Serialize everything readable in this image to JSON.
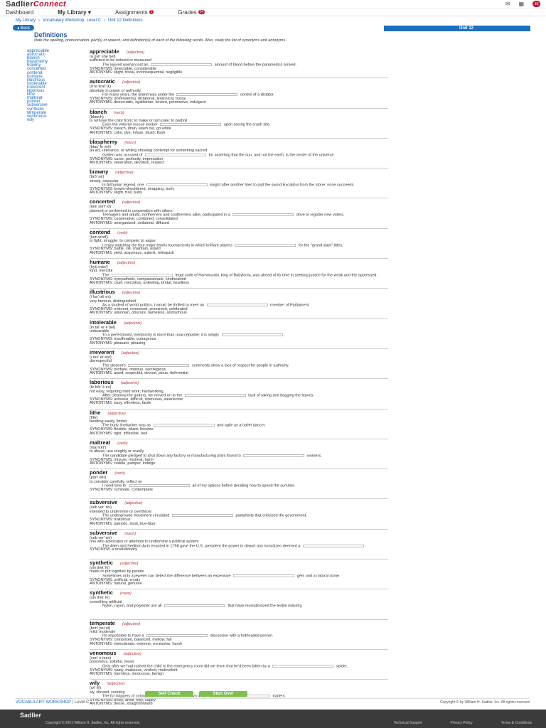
{
  "header": {
    "brand1": "Sadlier",
    "brand2": "Connect",
    "icon1": "envelope-icon",
    "icon2": "calendar-icon",
    "avatar": "JS"
  },
  "nav": {
    "dashboard": "Dashboard",
    "library": "My Library ▾",
    "assignments": "Assignments",
    "assign_badge": "1",
    "grades": "Grades",
    "grades_badge": "24"
  },
  "breadcrumb": {
    "a": "My Library",
    "b": "Vocabulary Workshop, Level C",
    "c": "Unit 12 Definitions"
  },
  "back": "◂ Back",
  "unit": "Unit 12",
  "title": "Definitions",
  "intro": "Note the spelling, pronunciation, part(s) of speech, and definition(s) of each of the following words. Also, study the list of synonyms and antonyms.",
  "sidebar": [
    "appreciable",
    "autocratic",
    "blanch",
    "blasphemy",
    "brawny",
    "concerted",
    "contend",
    "humane",
    "illustrious",
    "intolerable",
    "irreverent",
    "laborious",
    "lithe",
    "maltreat",
    "ponder",
    "subversive",
    "synthetic",
    "temperate",
    "venomous",
    "wily"
  ],
  "entries": [
    {
      "w": "appreciable",
      "p": "(adjective)",
      "pr": "(a prē' she bel)",
      "d": "sufficient to be noticed or measured",
      "e": "The injured woman lost an ____ amount of blood before the paramedics arrived.",
      "s": "SYNONYMS: detectable, considerable",
      "a": "ANTONYMS: slight, trivial, inconsequential, negligible"
    },
    {
      "w": "autocratic",
      "p": "(adjective)",
      "pr": "(ô te krat' ik)",
      "d": "absolute in power or authority",
      "e": "For many years, the island was under the ____ control of a dictator.",
      "s": "SYNONYMS: domineering, dictatorial, tyrannical, bossy",
      "a": "ANTONYMS: democratic, egalitarian, lenient, permissive, indulgent"
    },
    {
      "w": "blanch",
      "p": "(verb)",
      "pr": "(blanch)",
      "d": "to remove the color from; to make or turn pale; to parboil",
      "e": "Even the veteran rescue worker ____ upon seeing the crash site.",
      "s": "SYNONYMS: bleach, drain, wash out, go white",
      "a": "ANTONYMS: color, dye, infuse, blush, flush"
    },
    {
      "w": "blasphemy",
      "p": "(noun)",
      "pr": "(blas' fe mē)",
      "d": "an act, utterance, or writing showing contempt for something sacred",
      "e": "Galileo was accused of ____ for asserting that the sun, and not the earth, is the center of the universe.",
      "s": "SYNONYMS: curse, profanity, imprecation",
      "a": "ANTONYMS: veneration, devotion, respect"
    },
    {
      "w": "brawny",
      "p": "(adjective)",
      "pr": "(brô' nē)",
      "d": "strong, muscular",
      "e": "In Arthurian legend, one ____ knight after another tries to pull the sword Excalibur from the stone; none succeeds.",
      "s": "SYNONYMS: brawn-shouldered, strapping, burly",
      "a": "ANTONYMS: slight, frail, puny"
    },
    {
      "w": "concerted",
      "p": "(adjective)",
      "pr": "(ken sert' id)",
      "d": "planned or performed in cooperation with others",
      "e": "Teenagers and adults, northerners and southerners alike, participated in a ____ drive to register new voters.",
      "s": "SYNONYMS: cooperative, combined, consolidated",
      "a": "ANTONYMS: unorganized, unilateral, diffused"
    },
    {
      "w": "contend",
      "p": "(verb)",
      "pr": "(ken tend')",
      "d": "to fight, struggle; to compete; to argue",
      "e": "I enjoy watching the four major tennis tournaments in which brilliant players ____ for the \"grand slam\" titles.",
      "s": "SYNONYMS: battle, vie, maintain, assert",
      "a": "ANTONYMS: yield, acquiesce, submit, relinquish"
    },
    {
      "w": "humane",
      "p": "(adjective)",
      "pr": "(hyü mān')",
      "d": "kind, merciful",
      "e": "The ____ legal code of Hammurabi, king of Babylonia, was ahead of its time in seeking justice for the weak and the oppressed.",
      "s": "SYNONYMS: sympathetic, compassionate, kindhearted",
      "a": "ANTONYMS: cruel, merciless, unfeeling, brutal, heartless"
    },
    {
      "w": "illustrious",
      "p": "(adjective)",
      "pr": "(i lus' trē es)",
      "d": "very famous, distinguished",
      "e": "As a student of world politics, I would be thrilled to meet an ____ member of Parliament.",
      "s": "SYNONYMS: eminent, renowned, prominent, celebrated",
      "a": "ANTONYMS: unknown, obscure, nameless, anonymous"
    },
    {
      "w": "intolerable",
      "p": "(adjective)",
      "pr": "(in täl' er e bel)",
      "d": "unbearable",
      "e": "To a perfectionist, mediocrity is more than unacceptable; it is simply ____.",
      "s": "SYNONYMS: insufferable, outrageous",
      "a": "ANTONYMS: pleasant, pleasing"
    },
    {
      "w": "irreverent",
      "p": "(adjective)",
      "pr": "(i rev' er ent)",
      "d": "disrespectful",
      "e": "The student's ____ comments show a lack of respect for people in authority.",
      "s": "SYNONYMS: profane, impious, sacrilegious",
      "a": "ANTONYMS: awed, respectful, devout, pious, deferential"
    },
    {
      "w": "laborious",
      "p": "(adjective)",
      "pr": "(le bôr' ē es)",
      "d": "not easy, requiring hard work; hardworking",
      "e": "After cleaning the gutters, we moved on to the ____ task of raking and bagging the leaves.",
      "s": "SYNONYMS: arduous, difficult, strenuous, wearisome",
      "a": "ANTONYMS: easy, effortless, facile"
    },
    {
      "w": "lithe",
      "p": "(adjective)",
      "pr": "(līth)",
      "d": "bending easily, limber",
      "e": "The burly linebacker was as ____ and agile as a ballet dancer.",
      "s": "SYNONYMS: flexible, pliant, lissome",
      "a": "ANTONYMS: rigid, inflexible, taut"
    },
    {
      "w": "maltreat",
      "p": "(verb)",
      "pr": "(mal trēt')",
      "d": "to abuse, use roughly or cruelly",
      "e": "The candidate pledged to shut down any factory or manufacturing plant found to ____ workers.",
      "s": "SYNONYMS: misuse, mistreat, harm",
      "a": "ANTONYMS: coddle, pamper, indulge"
    },
    {
      "w": "ponder",
      "p": "(verb)",
      "pr": "(pän' der)",
      "d": "to consider carefully, reflect on",
      "e": "I need time to ____ all of my options before deciding how to spend the summer.",
      "s": "SYNONYMS: ruminate, contemplate",
      "a": ""
    },
    {
      "w": "subversive",
      "p": "(adjective)",
      "pr": "(seb ver' siv)",
      "d": "intended to undermine or overthrow",
      "e": "The underground movement circulated ____ pamphlets that criticized the government.",
      "s": "SYNONYMS: traitorous",
      "a": "ANTONYMS: patriotic, loyal, true-blue"
    },
    {
      "w": "subversive",
      "p": "(noun)",
      "pr": "(seb ver' siv)",
      "d": "one who advocates or attempts to undermine a political system",
      "e": "The Alien and Sedition Acts enacted in 1798 gave the U.S. president the power to deport any noncitizen deemed a ____.",
      "s": "SYNONYM: a revolutionary",
      "a": ""
    },
    {
      "w": "synthetic",
      "p": "(adjective)",
      "pr": "(sin thet' ik)",
      "d": "made or put together by people",
      "e": "Sometimes only a jeweler can detect the difference between an expensive ____ gem and a natural stone.",
      "s": "SYNONYMS: artificial, ersatz",
      "a": "ANTONYMS: natural, genuine"
    },
    {
      "w": "synthetic",
      "p": "(noun)",
      "pr": "(sin thet' ik)",
      "d": "something artificial",
      "e": "Nylon, rayon, and polyester are all ____ that have revolutionized the textile industry.",
      "s": "",
      "a": ""
    },
    {
      "w": "temperate",
      "p": "(adjective)",
      "pr": "(tem' per et)",
      "d": "mild, moderate",
      "e": "It's impossible to have a ____ discussion with a hotheaded person.",
      "s": "SYNONYMS: composed, balanced, mellow, fair",
      "a": "ANTONYMS: immoderate, extreme, excessive, harsh"
    },
    {
      "w": "venomous",
      "p": "(adjective)",
      "pr": "(ven' e mes)",
      "d": "poisonous; spiteful, mean",
      "e": "Only after we had rushed the child to the emergency room did we learn that he'd been bitten by a ____ spider.",
      "s": "SYNONYMS: nasty, malicious, virulent, malevolent",
      "a": "ANTONYMS: harmless, innocuous, benign"
    },
    {
      "w": "wily",
      "p": "(adjective)",
      "pr": "(wī' lē)",
      "d": "sly, shrewd, cunning",
      "e": "The fur trappers of colonial North America were known to be ____ traders.",
      "s": "SYNONYMS: tricky, artful, foxy, cagey",
      "a": "ANTONYMS: dense, straightforward"
    }
  ],
  "buttons": {
    "self_check": "Self Check",
    "start_over": "Start Over"
  },
  "footer": {
    "series": "VOCABULARY WORKSHOP",
    "level": "Level C",
    "copyright": "Copyright © by William H. Sadlier, Inc. All rights reserved.",
    "logo": "Sadlier",
    "bottom": "Copyright © 2021 William H. Sadlier, Inc. All rights reserved.",
    "support": "Technical Support",
    "privacy": "Privacy Policy",
    "terms": "Terms & Conditions"
  }
}
